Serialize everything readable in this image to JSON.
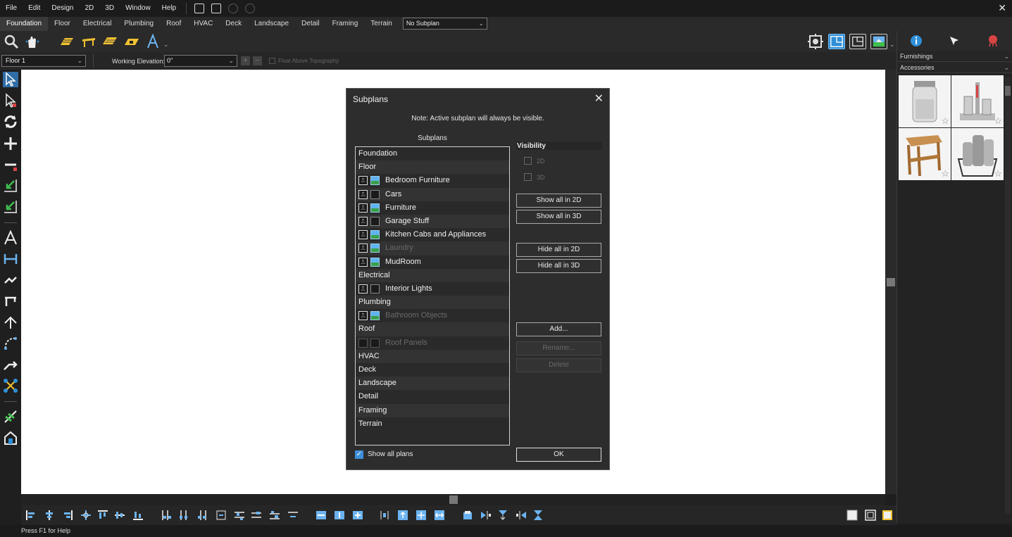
{
  "menu": {
    "items": [
      "File",
      "Edit",
      "Design",
      "2D",
      "3D",
      "Window",
      "Help"
    ],
    "close_glyph": "✕"
  },
  "tabs": {
    "items": [
      "Foundation",
      "Floor",
      "Electrical",
      "Plumbing",
      "Roof",
      "HVAC",
      "Deck",
      "Landscape",
      "Detail",
      "Framing",
      "Terrain"
    ],
    "active": "Foundation",
    "subplan_select": "No Subplan"
  },
  "floorbar": {
    "floor_select": "Floor 1",
    "elevation_label": "Working Elevation:",
    "elevation_value": "0\"",
    "float_label": "Float Above Topography"
  },
  "right_panel": {
    "library_combo": "Furnishings",
    "category_combo": "Accessories"
  },
  "status": {
    "text": "Press F1 for Help"
  },
  "colors": {
    "accent": "#2f8fd8",
    "tool_yellow": "#f2c230",
    "tool_green": "#3fbf4f",
    "tool_red": "#d94444"
  },
  "dialog": {
    "title": "Subplans",
    "close_glyph": "✕",
    "note": "Note: Active subplan will always be visible.",
    "list_header": "Subplans",
    "visibility_title": "Visibility",
    "vis_2d": "2D",
    "vis_3d": "3D",
    "buttons": {
      "show_2d": "Show all in 2D",
      "show_3d": "Show all in 3D",
      "hide_2d": "Hide all in 2D",
      "hide_3d": "Hide all in 3D",
      "add": "Add...",
      "rename": "Rename...",
      "delete": "Delete",
      "ok": "OK"
    },
    "show_all_label": "Show all plans",
    "rows": [
      {
        "type": "cat",
        "label": "Foundation"
      },
      {
        "type": "cat",
        "label": "Floor"
      },
      {
        "type": "sub",
        "label": "Bedroom Furniture",
        "v2d": true,
        "v3d": true,
        "enabled": true
      },
      {
        "type": "sub",
        "label": "Cars",
        "v2d": true,
        "v3d": false,
        "enabled": true
      },
      {
        "type": "sub",
        "label": "Furniture",
        "v2d": true,
        "v3d": true,
        "enabled": true
      },
      {
        "type": "sub",
        "label": "Garage Stuff",
        "v2d": true,
        "v3d": false,
        "enabled": true
      },
      {
        "type": "sub",
        "label": "Kitchen Cabs and Appliances",
        "v2d": true,
        "v3d": true,
        "enabled": true
      },
      {
        "type": "sub",
        "label": "Laundry",
        "v2d": true,
        "v3d": true,
        "enabled": false
      },
      {
        "type": "sub",
        "label": "MudRoom",
        "v2d": true,
        "v3d": true,
        "enabled": true
      },
      {
        "type": "cat",
        "label": "Electrical"
      },
      {
        "type": "sub",
        "label": "Interior Lights",
        "v2d": true,
        "v3d": false,
        "enabled": true
      },
      {
        "type": "cat",
        "label": "Plumbing"
      },
      {
        "type": "sub",
        "label": "Bathroom Objects",
        "v2d": true,
        "v3d": true,
        "enabled": false
      },
      {
        "type": "cat",
        "label": "Roof"
      },
      {
        "type": "sub",
        "label": "Roof Panels",
        "v2d": false,
        "v3d": false,
        "enabled": false
      },
      {
        "type": "cat",
        "label": "HVAC"
      },
      {
        "type": "cat",
        "label": "Deck"
      },
      {
        "type": "cat",
        "label": "Landscape"
      },
      {
        "type": "cat",
        "label": "Detail"
      },
      {
        "type": "cat",
        "label": "Framing"
      },
      {
        "type": "cat",
        "label": "Terrain"
      }
    ]
  }
}
